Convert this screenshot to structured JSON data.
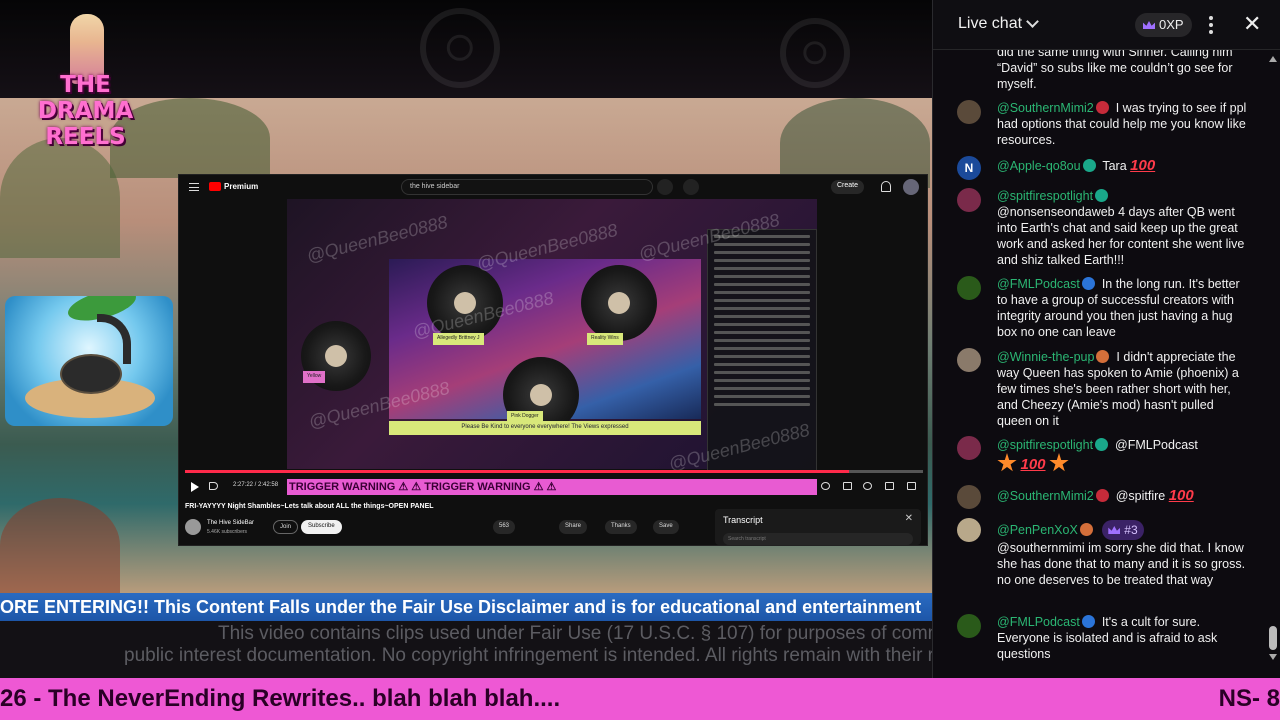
{
  "logo": {
    "line1": "THE",
    "line2": "DRAMA",
    "line3": "REELS"
  },
  "capture": {
    "brand": "Premium",
    "search_value": "the hive sidebar",
    "create_label": "Create",
    "watermark": "@QueenBee0888",
    "name_tags": [
      "Allegedly Brittney J",
      "Reality Wins",
      "Pink Dogger",
      "Yellow"
    ],
    "kind_banner": "Please Be Kind to everyone everywhere! The Views expressed",
    "time": "2:27:22 / 2:42:58",
    "progress": 0.9,
    "trigger_text": "TRIGGER WARNING ⚠ ⚠ TRIGGER WARNING ⚠ ⚠",
    "video_title": "FRI-YAYYYY Night Shambles~Lets talk about ALL the things~OPEN PANEL",
    "channel_name": "The Hive SideBar",
    "channel_subs": "5.46K subscribers",
    "join_label": "Join",
    "subscribe_label": "Subscribe",
    "actions": [
      "563",
      "Share",
      "Thanks",
      "Save"
    ],
    "transcript_title": "Transcript",
    "transcript_search": "Search transcript"
  },
  "disclaimer": "ORE ENTERING!! This Content Falls under the Fair Use Disclaimer and is for educational and entertainment",
  "fairuse": {
    "line1": "This video contains clips used under Fair Use (17 U.S.C. § 107) for purposes of commentary",
    "line2": "public interest documentation. No copyright infringement is intended. All rights remain with their respective"
  },
  "ticker": {
    "left": "26 - The NeverEnding Rewrites.. blah blah blah....",
    "right": "NS- 8"
  },
  "chat": {
    "title": "Live chat",
    "xp": "0XP",
    "messages": [
      {
        "author": "",
        "text": "did the same thing with Sinner. Calling him “David” so subs like me couldn’t go see for myself."
      },
      {
        "author": "@SouthernMimi2",
        "text": "I was trying to see if ppl had options that could help me you know like resources."
      },
      {
        "author": "@Apple-qo8ou",
        "text": "Tara",
        "emoji": "100"
      },
      {
        "author": "@spitfirespotlight",
        "text": "@nonsenseondaweb 4 days after QB went into Earth's chat and said keep up the great work and asked her for content she went live and shiz talked Earth!!!"
      },
      {
        "author": "@FMLPodcast",
        "text": "In the long run. It's better to have a group of successful creators with integrity around you then just having a hug box no one can leave"
      },
      {
        "author": "@Winnie-the-pup",
        "text": "I didn't appreciate the way Queen has spoken to Amie (phoenix) a few times she's been rather short with her, and Cheezy (Amie's mod) hasn't pulled queen on it"
      },
      {
        "author": "@spitfirespotlight",
        "text": "@FMLPodcast",
        "emoji": "100"
      },
      {
        "author": "@SouthernMimi2",
        "text": "@spitfire",
        "emoji": "100"
      },
      {
        "author": "@PenPenXoX",
        "rank": "#3",
        "text": "@southernmimi im sorry she did that. I know she has done that to many and it is so gross. no one deserves to be treated that way"
      },
      {
        "author": "@FMLPodcast",
        "text": "It's a cult for sure. Everyone is isolated and is afraid to ask questions"
      }
    ]
  },
  "colors": {
    "ticker": "#ee58d4",
    "disclaimer": "#2a6bc2",
    "chat_author": "#2bb673",
    "trigger": "#e85bd2"
  }
}
